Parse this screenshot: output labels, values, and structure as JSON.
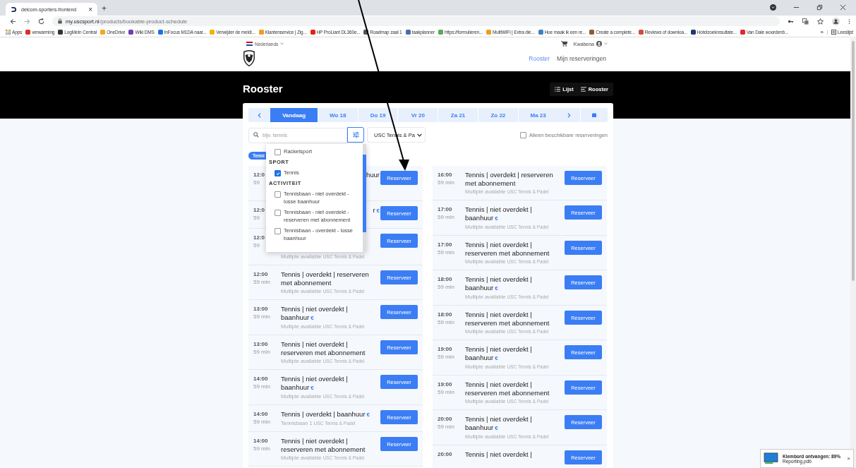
{
  "browser": {
    "tab": {
      "title": "delcom-sporters-frontend",
      "close": "×"
    },
    "new_tab": "+",
    "address": {
      "host": "my.uscsport.nl",
      "path": "/products/bookable-product-schedule"
    },
    "bookmarks": [
      {
        "kind": "apps",
        "label": "Apps"
      },
      {
        "kind": "site",
        "label": "verwarming",
        "color": "#d93025"
      },
      {
        "kind": "site",
        "label": "LogMeIn Central",
        "color": "#333333"
      },
      {
        "kind": "site",
        "label": "OneDrive",
        "color": "#f3a81c"
      },
      {
        "kind": "site",
        "label": "Wiki DMS",
        "color": "#6a3fb5"
      },
      {
        "kind": "site",
        "label": "InFocus M1DA naar...",
        "color": "#1a73e8"
      },
      {
        "kind": "site",
        "label": "Verwijder de meldi...",
        "color": "#f2b400"
      },
      {
        "kind": "site",
        "label": "Klantenservice | Zig...",
        "color": "#f29c1f"
      },
      {
        "kind": "site",
        "label": "HP ProLiant DL360e...",
        "color": "#e62117"
      },
      {
        "kind": "site",
        "label": "Roadmap zaal 1",
        "color": "#555555"
      },
      {
        "kind": "site",
        "label": "taakplanner",
        "color": "#4a6fa5"
      },
      {
        "kind": "site",
        "label": "https://formulieren...",
        "color": "#5aa85a"
      },
      {
        "kind": "site",
        "label": "MultiWiFi | Extra die...",
        "color": "#f29c1f"
      },
      {
        "kind": "site",
        "label": "Hoe maak ik een re...",
        "color": "#3f7fbf"
      },
      {
        "kind": "site",
        "label": "Create a complete...",
        "color": "#8a5a3c"
      },
      {
        "kind": "site",
        "label": "Reviews of downloa...",
        "color": "#d64a3a"
      },
      {
        "kind": "site",
        "label": "Hotelzoekresultate...",
        "color": "#1f3a6e"
      },
      {
        "kind": "site",
        "label": "Van Dale woordenb...",
        "color": "#e0282e"
      }
    ],
    "bookmarks_more": "»",
    "reading_list": "Leeslijst"
  },
  "header": {
    "language": "Nederlands",
    "user": "Kwabena",
    "nav": [
      {
        "label": "Rooster",
        "selected": true
      },
      {
        "label": "Mijn reserveringen",
        "selected": false
      }
    ]
  },
  "page_title": "Rooster",
  "view_toggle": [
    {
      "label": "Lijst",
      "kind": "list"
    },
    {
      "label": "Rooster",
      "kind": "schedule"
    }
  ],
  "date_tabs": [
    {
      "label": "Vandaag",
      "selected": true
    },
    {
      "label": "Wo 18",
      "selected": false
    },
    {
      "label": "Do 19",
      "selected": false
    },
    {
      "label": "Vr 20",
      "selected": false
    },
    {
      "label": "Za 21",
      "selected": false
    },
    {
      "label": "Zo 22",
      "selected": false
    },
    {
      "label": "Ma 23",
      "selected": false
    }
  ],
  "search": {
    "placeholder": "bijv. tennis"
  },
  "filter_button": {
    "active": true
  },
  "location_select": {
    "value": "USC Tennis & Pa"
  },
  "only_available": {
    "label": "Alleen beschikbare reserveringen",
    "checked": false
  },
  "filter_chip": "Tenni",
  "filter_menu": {
    "items": [
      {
        "kind": "option",
        "label": "Racketsport",
        "checked": false
      },
      {
        "kind": "header",
        "label": "SPORT"
      },
      {
        "kind": "option",
        "label": "Tennis",
        "checked": true
      },
      {
        "kind": "header",
        "label": "ACTIVITEIT"
      },
      {
        "kind": "option",
        "label": "Tennisbaan - niet overdekt - losse baanhuur",
        "checked": false
      },
      {
        "kind": "option",
        "label": "Tennisbaan - niet overdekt - reserveren met abonnement",
        "checked": false
      },
      {
        "kind": "option",
        "label": "Tennisbaan - overdekt - losse baanhuur",
        "checked": false
      }
    ]
  },
  "schedule": {
    "left": [
      {
        "kind": "covered",
        "time": "12:0",
        "duration": "59",
        "title": "huur",
        "button": "Reserveer"
      },
      {
        "kind": "covered",
        "time": "12:0",
        "duration": "59",
        "title": "r",
        "price": "€",
        "button": "Reserveer"
      },
      {
        "kind": "covered",
        "time": "12:0",
        "duration": "59",
        "availability": "Multiple available",
        "location": "USC Tennis & Padel",
        "button": "Reserveer"
      },
      {
        "kind": "slot",
        "time": "12:00",
        "duration": "59 min",
        "title": "Tennis | overdekt | reserveren met abonnement",
        "availability": "Multiple available",
        "location": "USC Tennis & Padel",
        "button": "Reserveer"
      },
      {
        "kind": "slot",
        "time": "13:00",
        "duration": "59 min",
        "title": "Tennis | niet overdekt | baanhuur",
        "price": "€",
        "availability": "Multiple available",
        "location": "USC Tennis & Padel",
        "button": "Reserveer"
      },
      {
        "kind": "slot",
        "time": "13:00",
        "duration": "59 min",
        "title": "Tennis | niet overdekt | reserveren met abonnement",
        "availability": "Multiple available",
        "location": "USC Tennis & Padel",
        "button": "Reserveer"
      },
      {
        "kind": "slot",
        "time": "14:00",
        "duration": "59 min",
        "title": "Tennis | niet overdekt | baanhuur",
        "price": "€",
        "availability": "Multiple available",
        "location": "USC Tennis & Padel",
        "button": "Reserveer"
      },
      {
        "kind": "slot",
        "time": "14:00",
        "duration": "59 min",
        "title": "Tennis | overdekt | baanhuur",
        "price": "€",
        "availability": "Tennisbaan 1",
        "location": "USC Tennis & Padel",
        "button": "Reserveer"
      },
      {
        "kind": "slot",
        "time": "14:00",
        "duration": "59 min",
        "title": "Tennis | niet overdekt | reserveren met abonnement",
        "availability": "Multiple available",
        "location": "USC Tennis & Padel",
        "button": "Reserveer"
      }
    ],
    "right": [
      {
        "kind": "slot",
        "time": "16:00",
        "duration": "59 min",
        "title": "Tennis | overdekt | reserveren met abonnement",
        "availability": "Multiple available",
        "location": "USC Tennis & Padel",
        "button": "Reserveer"
      },
      {
        "kind": "slot",
        "time": "17:00",
        "duration": "59 min",
        "title": "Tennis | niet overdekt | baanhuur",
        "price": "€",
        "availability": "Multiple available",
        "location": "USC Tennis & Padel",
        "button": "Reserveer"
      },
      {
        "kind": "slot",
        "time": "17:00",
        "duration": "59 min",
        "title": "Tennis | niet overdekt | reserveren met abonnement",
        "availability": "Multiple available",
        "location": "USC Tennis & Padel",
        "button": "Reserveer"
      },
      {
        "kind": "slot",
        "time": "18:00",
        "duration": "59 min",
        "title": "Tennis | niet overdekt | baanhuur",
        "price": "€",
        "availability": "Multiple available",
        "location": "USC Tennis & Padel",
        "button": "Reserveer"
      },
      {
        "kind": "slot",
        "time": "18:00",
        "duration": "59 min",
        "title": "Tennis | niet overdekt | reserveren met abonnement",
        "availability": "Multiple available",
        "location": "USC Tennis & Padel",
        "button": "Reserveer"
      },
      {
        "kind": "slot",
        "time": "19:00",
        "duration": "59 min",
        "title": "Tennis | niet overdekt | baanhuur",
        "price": "€",
        "availability": "Multiple available",
        "location": "USC Tennis & Padel",
        "button": "Reserveer"
      },
      {
        "kind": "slot",
        "time": "19:00",
        "duration": "59 min",
        "title": "Tennis | niet overdekt | reserveren met abonnement",
        "availability": "Multiple available",
        "location": "USC Tennis & Padel",
        "button": "Reserveer"
      },
      {
        "kind": "slot",
        "time": "20:00",
        "duration": "59 min",
        "title": "Tennis | niet overdekt | baanhuur",
        "price": "€",
        "availability": "Multiple available",
        "location": "USC Tennis & Padel",
        "button": "Reserveer"
      },
      {
        "kind": "slot",
        "time": "20:00",
        "title": "Tennis | niet overdekt |",
        "button": "Reserveer"
      }
    ]
  },
  "notification": {
    "title": "Klembord ontvangen: 89%",
    "file": "Reporting.pdb",
    "close": "×"
  }
}
